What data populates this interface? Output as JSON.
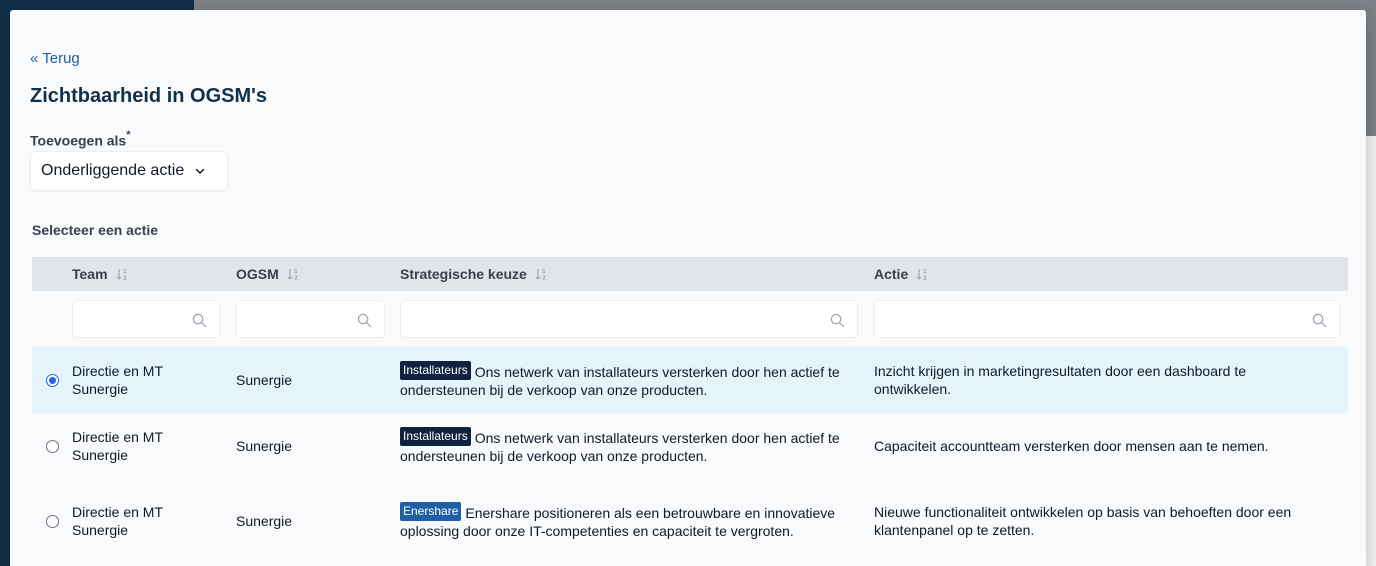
{
  "modal": {
    "back_label": "« Terug",
    "title": "Zichtbaarheid in OGSM's",
    "add_as": {
      "label": "Toevoegen als",
      "required_mark": "*",
      "value": "Onderliggende actie"
    },
    "select_label": "Selecteer een actie"
  },
  "table": {
    "columns": [
      {
        "key": "team",
        "label": "Team"
      },
      {
        "key": "ogsm",
        "label": "OGSM"
      },
      {
        "key": "keuze",
        "label": "Strategische keuze"
      },
      {
        "key": "actie",
        "label": "Actie"
      }
    ],
    "filters": {
      "team": "",
      "ogsm": "",
      "keuze": "",
      "actie": ""
    },
    "rows": [
      {
        "selected": true,
        "team": "Directie en MT Sunergie",
        "ogsm": "Sunergie",
        "tag": "Installateurs",
        "tag_color": "#0f2340",
        "keuze": "Ons netwerk van installateurs versterken door hen actief te ondersteunen bij de verkoop van onze producten.",
        "actie": "Inzicht krijgen in marketingresultaten door een dashboard te ontwikkelen."
      },
      {
        "selected": false,
        "team": "Directie en MT Sunergie",
        "ogsm": "Sunergie",
        "tag": "Installateurs",
        "tag_color": "#0f2340",
        "keuze": "Ons netwerk van installateurs versterken door hen actief te ondersteunen bij de verkoop van onze producten.",
        "actie": "Capaciteit accountteam versterken door mensen aan te nemen."
      },
      {
        "selected": false,
        "team": "Directie en MT Sunergie",
        "ogsm": "Sunergie",
        "tag": "Enershare",
        "tag_color": "#1f5fa6",
        "keuze": "Enershare positioneren als een betrouwbare en innovatieve oplossing door onze IT-competenties en capaciteit te vergroten.",
        "actie": "Nieuwe functionaliteit ontwikkelen op basis van behoeften door een klantenpanel op te zetten."
      }
    ]
  },
  "colors": {
    "accent": "#1f5fa6",
    "title": "#12304a",
    "selected_row": "#e3f4fb",
    "header_bg": "#e1e4e8"
  }
}
